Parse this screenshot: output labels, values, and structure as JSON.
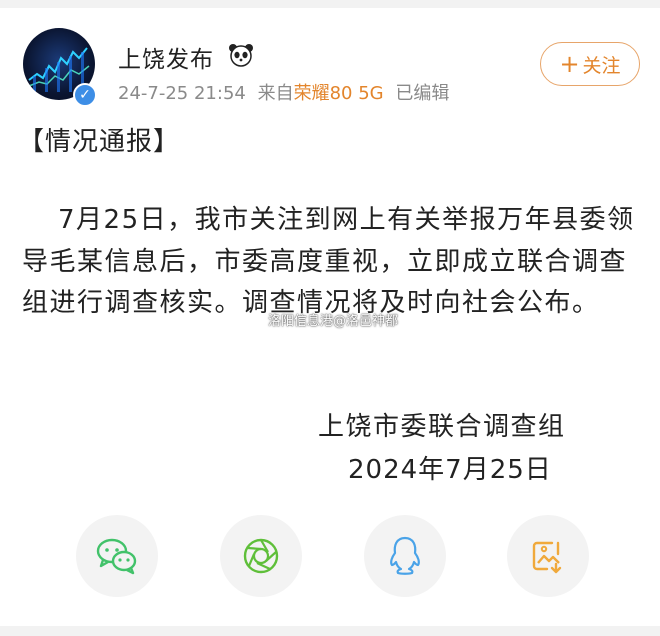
{
  "post": {
    "author": "上饶发布",
    "timestamp": "24-7-25 21:54",
    "source_prefix": "来自",
    "device": "荣耀80 5G",
    "edited": "已编辑",
    "follow_label": "关注",
    "title": "【情况通报】",
    "body": "7月25日，我市关注到网上有关举报万年县委领导毛某信息后，市委高度重视，立即成立联合调查组进行调查核实。调查情况将及时向社会公布。",
    "signature_org": "上饶市委联合调查组",
    "signature_date": "2024年7月25日"
  },
  "watermark": "洛阳信息港@洛邑神都",
  "share": [
    {
      "name": "wechat",
      "icon": "wechat-icon",
      "color": "#42c26a"
    },
    {
      "name": "moments",
      "icon": "moments-icon",
      "color": "#5fbf3a"
    },
    {
      "name": "qq",
      "icon": "qq-icon",
      "color": "#4aa3e8"
    },
    {
      "name": "save-image",
      "icon": "save-image-icon",
      "color": "#f0a93b"
    }
  ],
  "colors": {
    "accent": "#e3852c",
    "verified": "#3d8ee6",
    "meta": "#8a8a8a"
  }
}
